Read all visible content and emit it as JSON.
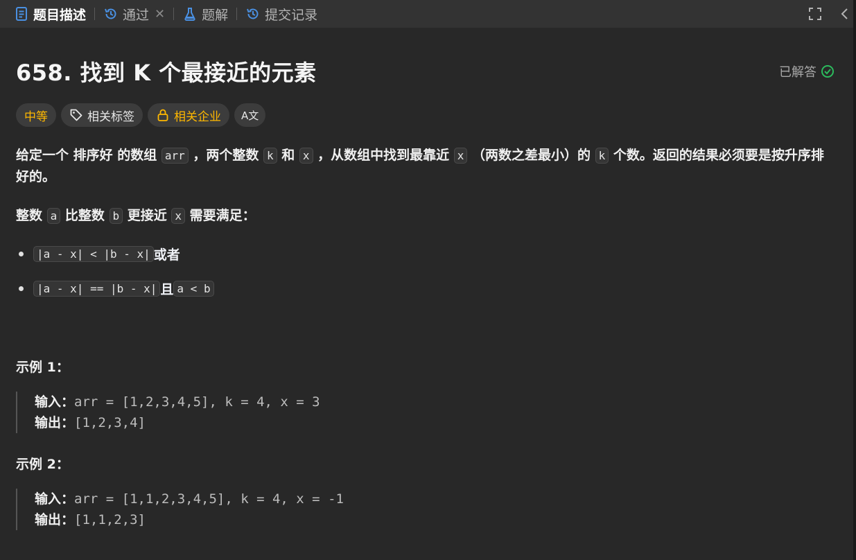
{
  "tabs": [
    {
      "label": "题目描述",
      "icon": "document-icon"
    },
    {
      "label": "通过",
      "icon": "history-icon"
    },
    {
      "label": "题解",
      "icon": "flask-icon"
    },
    {
      "label": "提交记录",
      "icon": "history-icon"
    }
  ],
  "problem": {
    "title": "658. 找到 K 个最接近的元素",
    "status": "已解答",
    "difficulty": "中等",
    "tags_label": "相关标签",
    "company_label": "相关企业",
    "translate_glyph": "A文"
  },
  "desc": {
    "p1_a": "给定一个 ",
    "p1_bold": "排序好",
    "p1_b": " 的数组 ",
    "code_arr": "arr",
    "p1_c": " ，两个整数 ",
    "code_k": "k",
    "p1_d": " 和 ",
    "code_x": "x",
    "p1_e": " ，从数组中找到最靠近 ",
    "p1_f": " （两数之差最小）的 ",
    "p1_g": " 个数。返回的结果必须要是按升序排好的。",
    "p2_a": "整数 ",
    "code_a": "a",
    "p2_b": " 比整数 ",
    "code_b": "b",
    "p2_c": " 更接近 ",
    "p2_d": " 需要满足：",
    "bullet1_code": "|a - x| < |b - x|",
    "bullet1_text": " 或者",
    "bullet2_code": "|a - x| == |b - x|",
    "bullet2_text": " 且 ",
    "bullet2_code2": "a < b"
  },
  "examples": [
    {
      "title": "示例 1：",
      "input_label": "输入：",
      "input": "arr = [1,2,3,4,5], k = 4, x = 3",
      "output_label": "输出：",
      "output": "[1,2,3,4]"
    },
    {
      "title": "示例 2：",
      "input_label": "输入：",
      "input": "arr = [1,1,2,3,4,5], k = 4, x = -1",
      "output_label": "输出：",
      "output": "[1,1,2,3]"
    }
  ],
  "colors": {
    "accent": "#ffb800",
    "solved": "#2cbb5d",
    "link": "#4a90e2"
  }
}
